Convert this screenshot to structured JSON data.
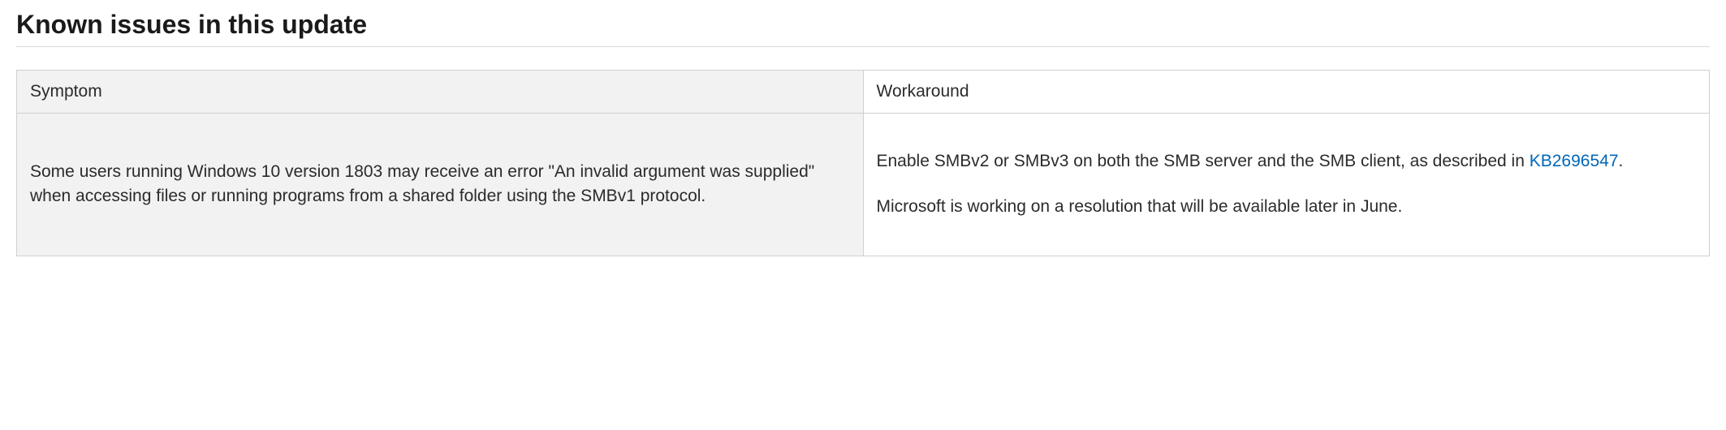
{
  "heading": "Known issues in this update",
  "table": {
    "headers": {
      "symptom": "Symptom",
      "workaround": "Workaround"
    },
    "rows": [
      {
        "symptom": "Some users running Windows 10 version 1803 may receive an error \"An invalid argument was supplied\" when accessing files or running programs from a shared folder using the SMBv1 protocol.",
        "workaround": {
          "p1_before_link": "Enable SMBv2 or SMBv3 on both the SMB server and the SMB client, as described in ",
          "link_text": "KB2696547",
          "p1_after_link": ".",
          "p2": "Microsoft is working on a resolution that will be available later in June."
        }
      }
    ]
  }
}
